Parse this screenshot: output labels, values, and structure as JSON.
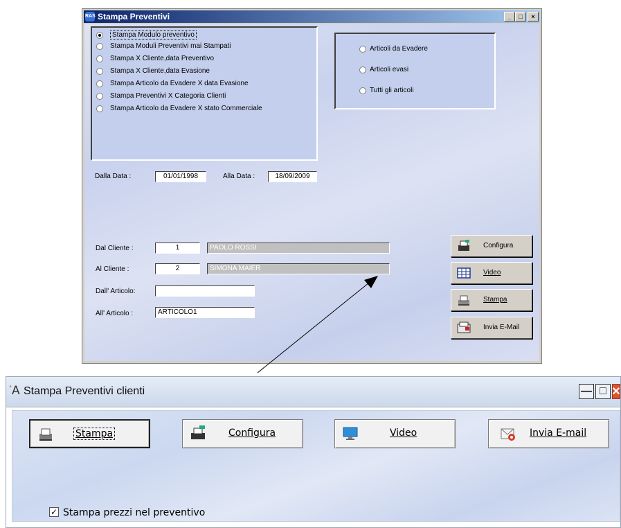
{
  "old_window": {
    "title": "Stampa Preventivi",
    "app_icon": "RAS",
    "controls": {
      "minimize": "_",
      "maximize": "□",
      "close": "×"
    },
    "report_options": [
      {
        "label": "Stampa Modulo preventivo",
        "selected": true
      },
      {
        "label": "Stampa Moduli Preventivi mai Stampati",
        "selected": false
      },
      {
        "label": "Stampa X Cliente,data Preventivo",
        "selected": false
      },
      {
        "label": "Stampa X Cliente,data Evasione",
        "selected": false
      },
      {
        "label": "Stampa Articolo da Evadere X data Evasione",
        "selected": false
      },
      {
        "label": "Stampa Preventivi X Categoria Clienti",
        "selected": false
      },
      {
        "label": "Stampa Articolo da Evadere X stato Commerciale",
        "selected": false
      }
    ],
    "article_options": [
      {
        "label": "Articoli da Evadere",
        "selected": false
      },
      {
        "label": "Articoli evasi",
        "selected": false
      },
      {
        "label": "Tutti gli articoli",
        "selected": false
      }
    ],
    "dalla_data_label": "Dalla Data :",
    "dalla_data_value": "01/01/1998",
    "alla_data_label": "Alla Data :",
    "alla_data_value": "18/09/2009",
    "dal_cliente_label": "Dal Cliente :",
    "dal_cliente_code": "1",
    "dal_cliente_name": "PAOLO ROSSI",
    "al_cliente_label": "Al Cliente :",
    "al_cliente_code": "2",
    "al_cliente_name": "SIMONA MAIER",
    "dall_articolo_label": "Dall' Articolo:",
    "dall_articolo_value": "",
    "all_articolo_label": "All' Articolo :",
    "all_articolo_value": "ARTICOLO1",
    "buttons": {
      "configura": "Configura",
      "video": "Video",
      "stampa": "Stampa",
      "invia_email": "Invia E-Mail"
    }
  },
  "new_window": {
    "title": "Stampa Preventivi clienti",
    "app_icon": "A",
    "controls": {
      "minimize": "—",
      "maximize": "□",
      "close": "✕"
    },
    "buttons": {
      "stampa": "Stampa",
      "configura": "Configura",
      "video": "Video",
      "invia_email": "Invia E-mail"
    },
    "checkbox_label": "Stampa prezzi nel preventivo",
    "checkbox_checked": true,
    "checkbox_mark": "✓"
  },
  "colors": {
    "titlebar_old_start": "#0a246a",
    "titlebar_old_end": "#a6caf0",
    "panel_bg": "#c3cfec",
    "close_button": "#d9552e"
  }
}
